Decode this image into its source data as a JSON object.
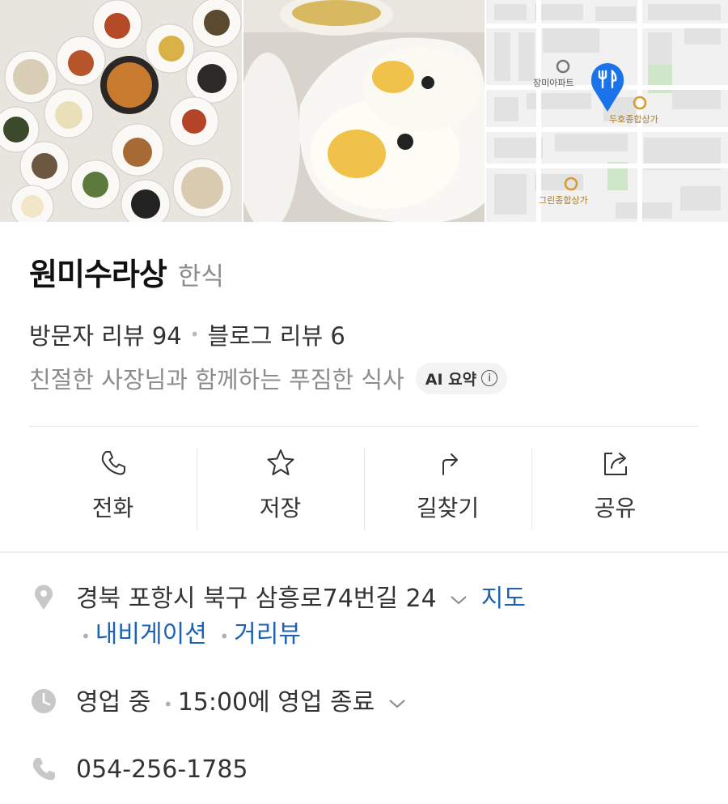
{
  "place": {
    "name": "원미수라상",
    "category": "한식"
  },
  "reviews": {
    "visitor": "방문자 리뷰 94",
    "blog": "블로그 리뷰 6"
  },
  "summary": {
    "text": "친절한 사장님과 함께하는 푸짐한 식사",
    "badge": "AI 요약",
    "badge_icon": "info-icon"
  },
  "actions": [
    {
      "label": "전화",
      "icon": "phone-icon"
    },
    {
      "label": "저장",
      "icon": "star-icon"
    },
    {
      "label": "길찾기",
      "icon": "directions-icon"
    },
    {
      "label": "공유",
      "icon": "share-icon"
    }
  ],
  "map": {
    "labels": [
      "장미아파트",
      "두호종합상가",
      "그린종합상가"
    ],
    "pin_icon": "restaurant-pin-icon"
  },
  "address": {
    "text": "경북 포항시 북구 삼흥로74번길 24",
    "map_link": "지도",
    "nav_link": "내비게이션",
    "street_link": "거리뷰"
  },
  "hours": {
    "status": "영업 중",
    "close": "15:00에 영업 종료"
  },
  "phone": {
    "number": "054-256-1785"
  },
  "colors": {
    "link": "#1e62b5",
    "pin": "#1a73e8",
    "text_muted": "#8c8c8c"
  }
}
